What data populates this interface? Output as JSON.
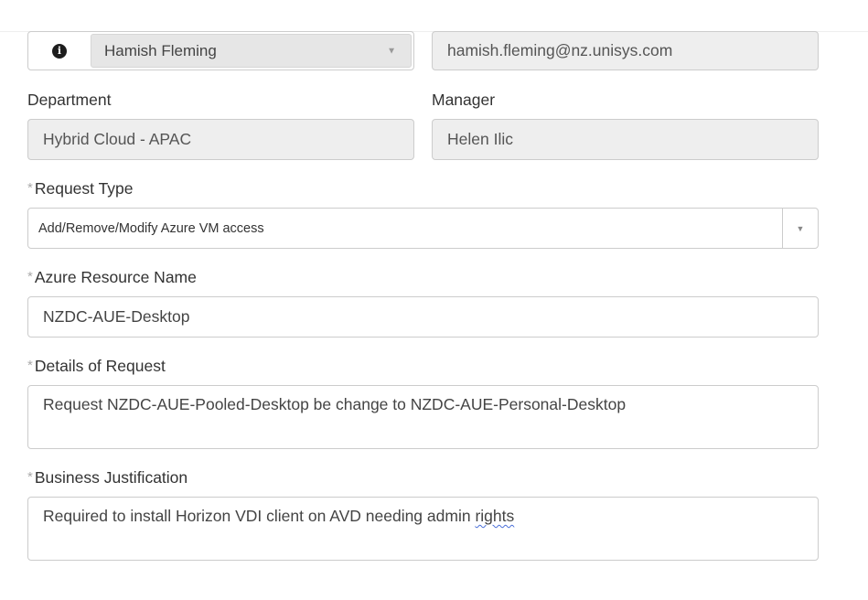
{
  "user": {
    "name": "Hamish Fleming",
    "email": "hamish.fleming@nz.unisys.com",
    "info_icon": "info-icon",
    "caret_icon": "caret-down-icon"
  },
  "department": {
    "label": "Department",
    "value": "Hybrid Cloud - APAC"
  },
  "manager": {
    "label": "Manager",
    "value": "Helen Ilic"
  },
  "request_type": {
    "required_mark": "*",
    "label": "Request Type",
    "value": "Add/Remove/Modify Azure VM access"
  },
  "azure_resource": {
    "required_mark": "*",
    "label": "Azure Resource Name",
    "value": "NZDC-AUE-Desktop"
  },
  "details": {
    "required_mark": "*",
    "label": "Details of Request",
    "value": "Request NZDC-AUE-Pooled-Desktop be change to NZDC-AUE-Personal-Desktop"
  },
  "justification": {
    "required_mark": "*",
    "label": "Business Justification",
    "value_prefix": "Required to install Horizon VDI client on AVD needing admin ",
    "value_flagged_word": "rights"
  }
}
